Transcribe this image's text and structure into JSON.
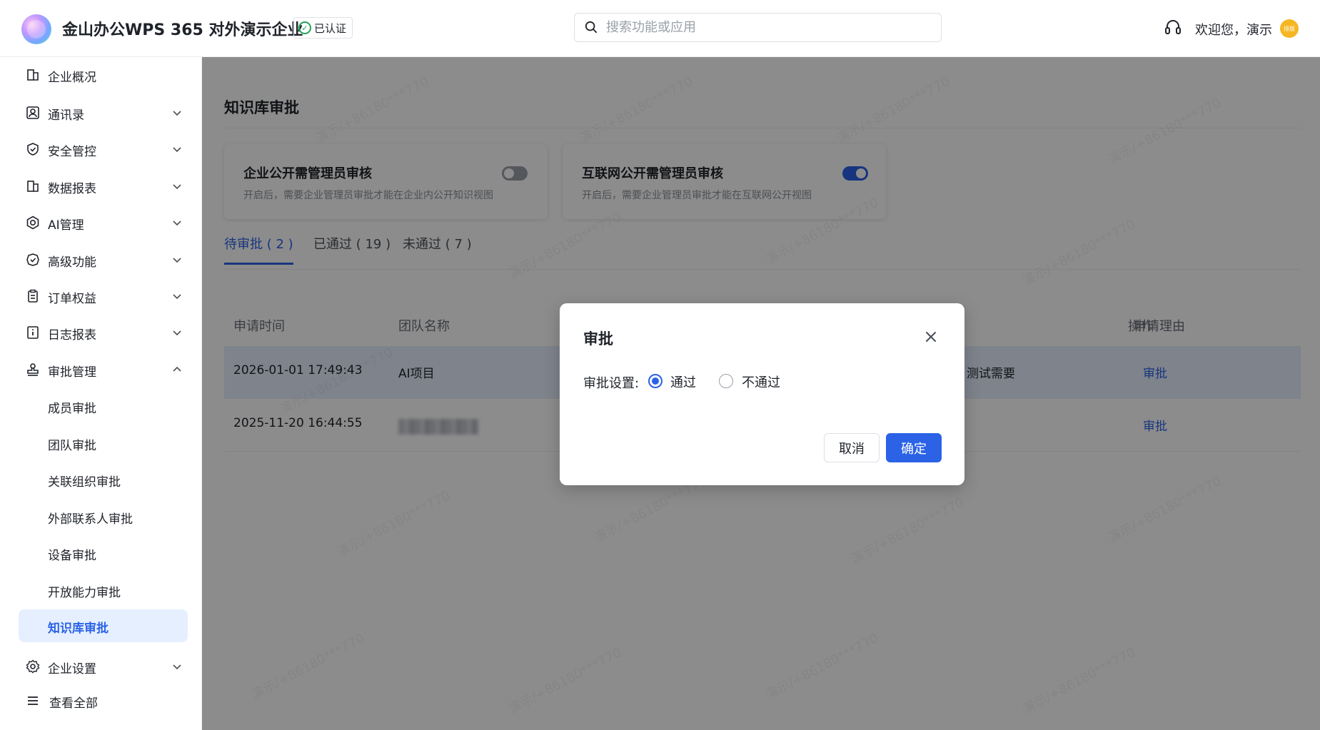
{
  "header": {
    "org_name": "金山办公WPS 365 对外演示企业",
    "verified_label": "已认证",
    "search_placeholder": "搜索功能或应用",
    "welcome": "欢迎您，演示",
    "avatar_text": "排版"
  },
  "sidebar": {
    "items": [
      {
        "label": "企业概况",
        "icon": "building-icon",
        "expandable": false
      },
      {
        "label": "通讯录",
        "icon": "contacts-icon",
        "expandable": true
      },
      {
        "label": "安全管控",
        "icon": "shield-icon",
        "expandable": true
      },
      {
        "label": "数据报表",
        "icon": "report-icon",
        "expandable": true
      },
      {
        "label": "AI管理",
        "icon": "ai-icon",
        "expandable": true
      },
      {
        "label": "高级功能",
        "icon": "premium-icon",
        "expandable": true
      },
      {
        "label": "订单权益",
        "icon": "order-icon",
        "expandable": true
      },
      {
        "label": "日志报表",
        "icon": "log-icon",
        "expandable": true
      },
      {
        "label": "审批管理",
        "icon": "stamp-icon",
        "expandable": true,
        "expanded": true
      }
    ],
    "sub_items": [
      "成员审批",
      "团队审批",
      "关联组织审批",
      "外部联系人审批",
      "设备审批",
      "开放能力审批",
      "知识库审批"
    ],
    "active_sub": "知识库审批",
    "settings": {
      "label": "企业设置",
      "icon": "gear-icon"
    },
    "view_all": {
      "label": "查看全部",
      "icon": "menu-icon"
    }
  },
  "main": {
    "title": "知识库审批",
    "cards": [
      {
        "title": "企业公开需管理员审核",
        "desc": "开启后，需要企业管理员审批才能在企业内公开知识视图",
        "enabled": false
      },
      {
        "title": "互联网公开需管理员审核",
        "desc": "开启后，需要企业管理员审批才能在互联网公开视图",
        "enabled": true
      }
    ],
    "tabs": [
      {
        "label": "待审批 ( 2 )",
        "active": true
      },
      {
        "label": "已通过 ( 19 )",
        "active": false
      },
      {
        "label": "未通过 ( 7 )",
        "active": false
      }
    ],
    "columns": [
      "申请时间",
      "团队名称",
      "申请理由",
      "操作"
    ],
    "rows": [
      {
        "time": "2026-01-01 17:49:43",
        "team": "AI项目",
        "reason": "测试需要",
        "action": "审批"
      },
      {
        "time": "2025-11-20 16:44:55",
        "team": "",
        "reason": "",
        "action": "审批"
      }
    ],
    "watermark": "演示/+86180***770"
  },
  "modal": {
    "title": "审批",
    "field_label": "审批设置:",
    "options": [
      {
        "label": "通过",
        "checked": true
      },
      {
        "label": "不通过",
        "checked": false
      }
    ],
    "cancel_label": "取消",
    "ok_label": "确定"
  },
  "colors": {
    "accent": "#2b62e6",
    "active_bg": "#e6efff",
    "verified_green": "#20a35a",
    "avatar_bg": "#f5b623"
  }
}
